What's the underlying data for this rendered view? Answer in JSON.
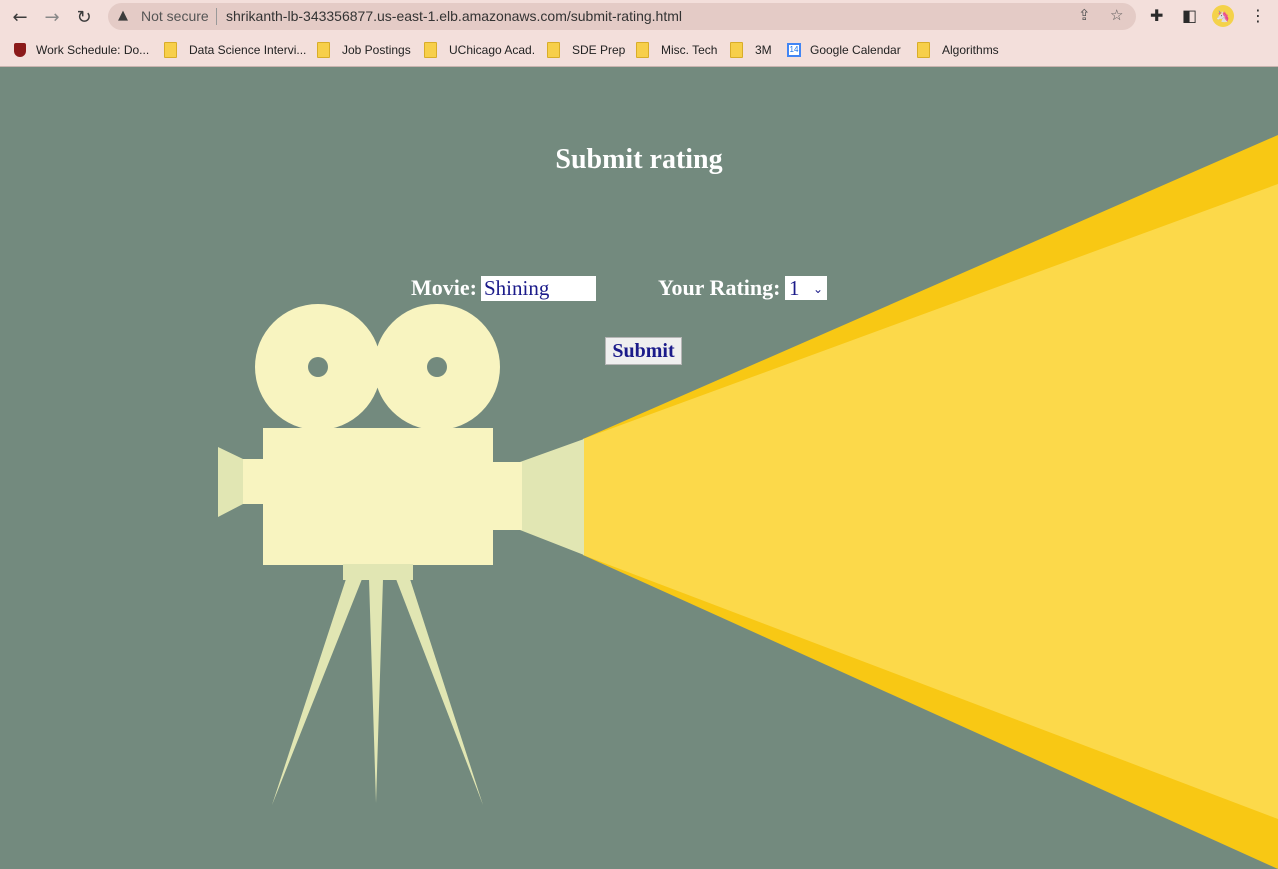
{
  "browser": {
    "security_label": "Not secure",
    "url": "shrikanth-lb-343356877.us-east-1.elb.amazonaws.com/submit-rating.html",
    "avatar_text": "🦄",
    "bookmarks": [
      {
        "label": "Work Schedule: Do...",
        "icon": "uchicago-icon"
      },
      {
        "label": "Data Science Intervi...",
        "icon": "folder-icon"
      },
      {
        "label": "Job Postings",
        "icon": "folder-icon"
      },
      {
        "label": "UChicago Acad.",
        "icon": "folder-icon"
      },
      {
        "label": "SDE Prep",
        "icon": "folder-icon"
      },
      {
        "label": "Misc. Tech",
        "icon": "folder-icon"
      },
      {
        "label": "3M",
        "icon": "folder-icon"
      },
      {
        "label": "Google Calendar",
        "icon": "calendar-icon"
      },
      {
        "label": "Algorithms",
        "icon": "folder-icon"
      }
    ],
    "calendar_day": "14"
  },
  "page": {
    "title": "Submit rating",
    "movie_label": "Movie:",
    "movie_value": "Shining",
    "rating_label": "Your Rating:",
    "rating_value": "1",
    "submit_label": "Submit"
  },
  "colors": {
    "background": "#738a7e",
    "camera": "#f8f4c0",
    "beam": "#fcd94a",
    "beam_edge": "#f8c814"
  }
}
